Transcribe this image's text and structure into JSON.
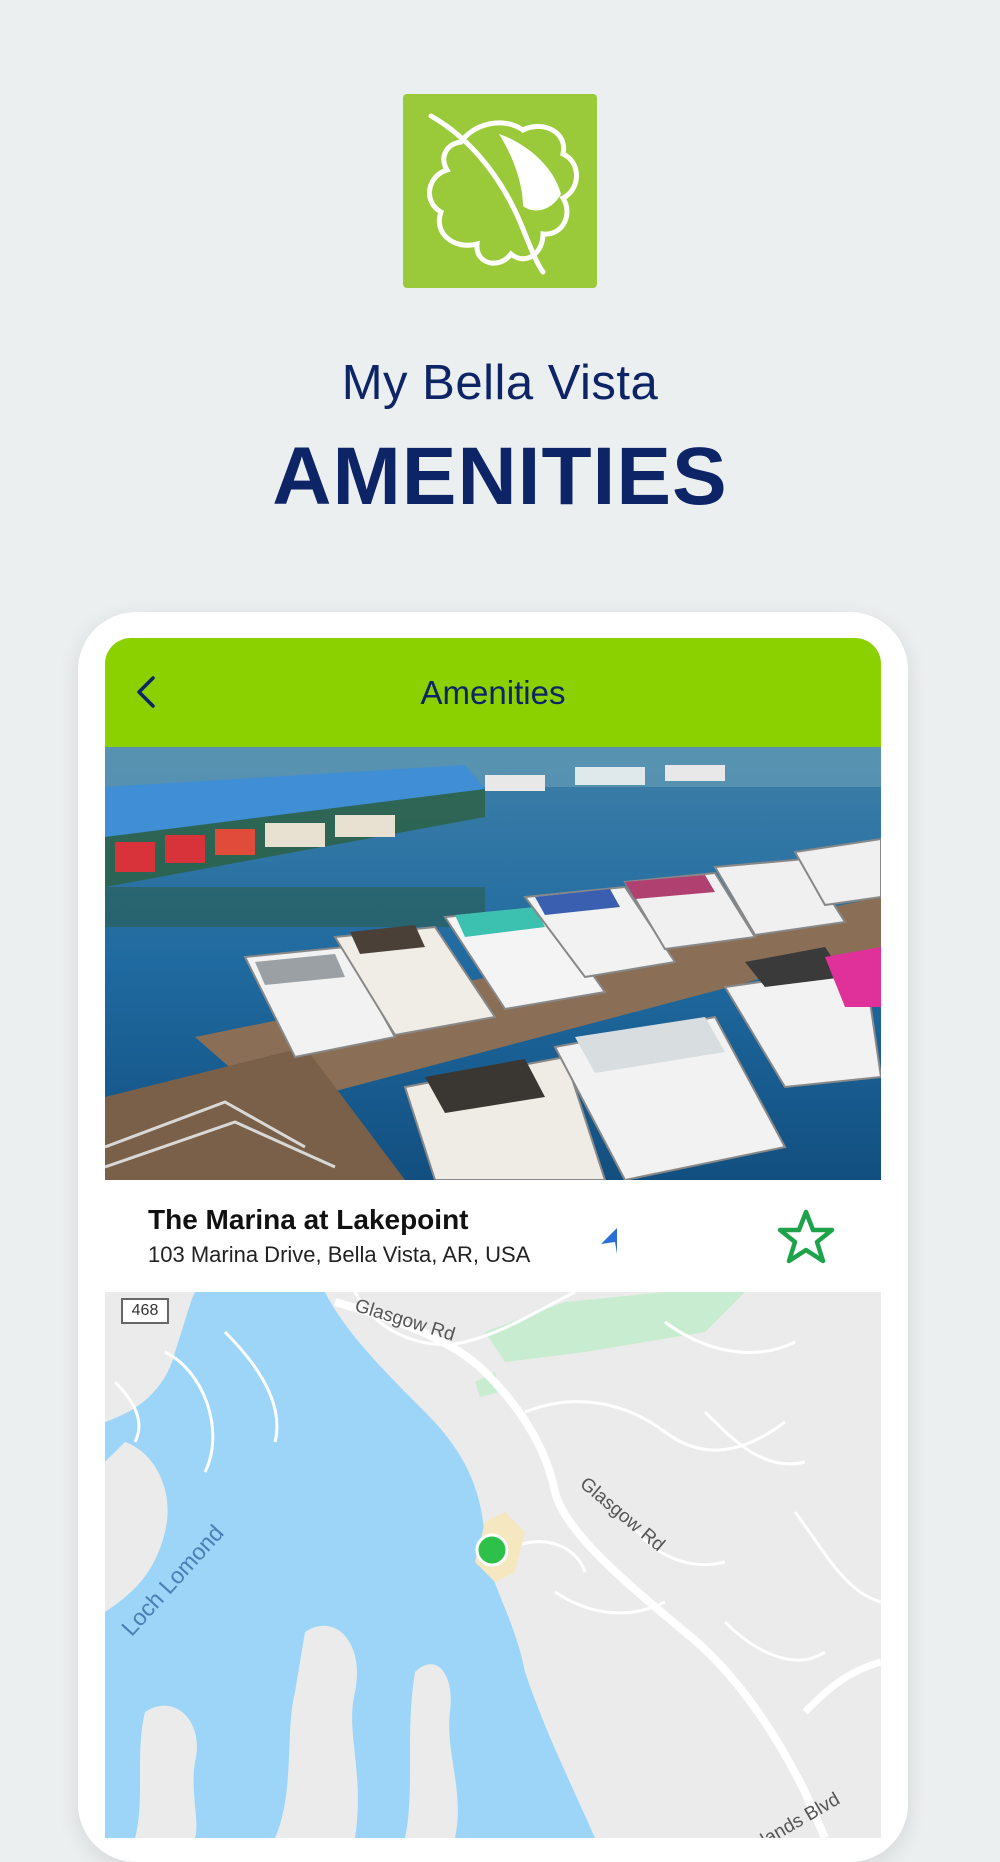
{
  "header": {
    "subtitle": "My Bella Vista",
    "title": "AMENITIES",
    "logo": "leaf-logo"
  },
  "app": {
    "appbar_title": "Amenities",
    "back_icon": "chevron-left-icon",
    "place": {
      "name": "The Marina at Lakepoint",
      "address": "103 Marina Drive, Bella Vista, AR, USA"
    },
    "navigate_icon": "navigation-arrow-icon",
    "favorite_icon": "star-outline-icon",
    "map": {
      "route_shield": "468",
      "roads": [
        "Glasgow Rd",
        "Glasgow Rd",
        "hlands Blvd"
      ],
      "water": "Loch Lomond"
    }
  },
  "colors": {
    "appbar": "#8bd100",
    "brand_navy": "#0d2466",
    "logo_green": "#9ac93a",
    "star": "#1fa34a",
    "marker": "#2ec14a",
    "water": "#9cd5f8"
  }
}
